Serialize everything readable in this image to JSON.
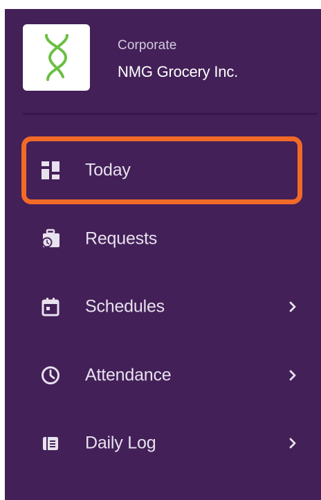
{
  "org": {
    "subtitle": "Corporate",
    "name": "NMG Grocery Inc.",
    "logo_icon": "green-x-logo"
  },
  "nav": {
    "items": [
      {
        "label": "Today",
        "icon": "dashboard-icon",
        "active": true,
        "has_submenu": false
      },
      {
        "label": "Requests",
        "icon": "request-bag-icon",
        "active": false,
        "has_submenu": false
      },
      {
        "label": "Schedules",
        "icon": "calendar-icon",
        "active": false,
        "has_submenu": true
      },
      {
        "label": "Attendance",
        "icon": "clock-icon",
        "active": false,
        "has_submenu": true
      },
      {
        "label": "Daily Log",
        "icon": "log-book-icon",
        "active": false,
        "has_submenu": true
      }
    ]
  },
  "colors": {
    "sidebar_bg": "#432058",
    "active_outline": "#f26a28",
    "logo_green": "#6cbf43",
    "text_primary": "#ffffff",
    "text_secondary": "#d6cbe0"
  }
}
